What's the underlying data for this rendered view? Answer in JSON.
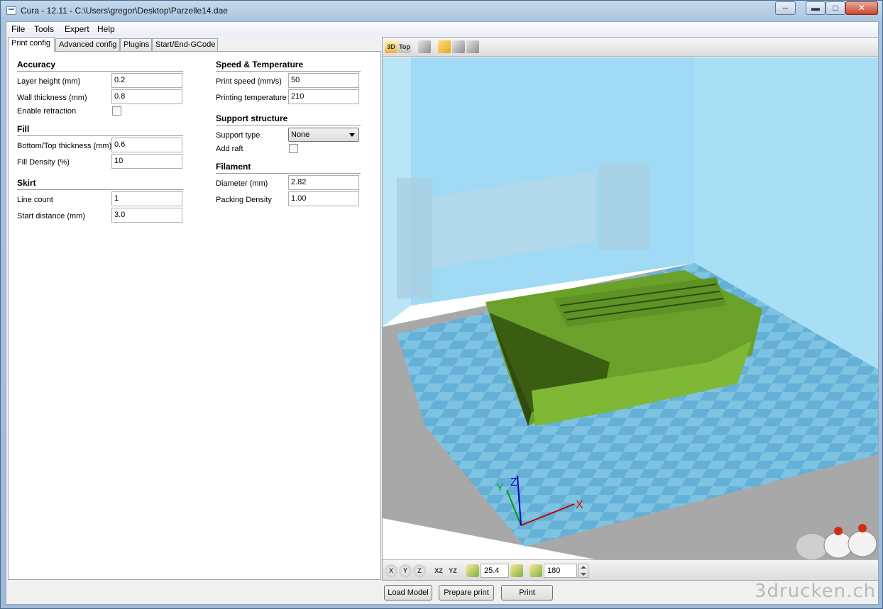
{
  "window": {
    "title": "Cura - 12.11 - C:\\Users\\gregor\\Desktop\\Parzelle14.dae",
    "restore_icon": "⇔",
    "minimize_icon": "▬",
    "maximize_icon": "□",
    "close_icon": "✕"
  },
  "menu": [
    "File",
    "Tools",
    "Expert",
    "Help"
  ],
  "tabs": [
    "Print config",
    "Advanced config",
    "Plugins",
    "Start/End-GCode"
  ],
  "sections": {
    "accuracy": {
      "title": "Accuracy",
      "layer_height_label": "Layer height (mm)",
      "layer_height": "0.2",
      "wall_thickness_label": "Wall thickness (mm)",
      "wall_thickness": "0.8",
      "enable_retraction_label": "Enable retraction",
      "enable_retraction": false
    },
    "fill": {
      "title": "Fill",
      "bottom_top_label": "Bottom/Top thickness (mm)",
      "bottom_top": "0.6",
      "fill_density_label": "Fill Density (%)",
      "fill_density": "10"
    },
    "skirt": {
      "title": "Skirt",
      "line_count_label": "Line count",
      "line_count": "1",
      "start_distance_label": "Start distance (mm)",
      "start_distance": "3.0"
    },
    "speed": {
      "title": "Speed & Temperature",
      "print_speed_label": "Print speed (mm/s)",
      "print_speed": "50",
      "temp_label": "Printing temperature",
      "temp": "210"
    },
    "support": {
      "title": "Support structure",
      "type_label": "Support type",
      "type": "None",
      "raft_label": "Add raft",
      "raft": false
    },
    "filament": {
      "title": "Filament",
      "diameter_label": "Diameter (mm)",
      "diameter": "2.82",
      "packing_label": "Packing Density",
      "packing": "1.00"
    }
  },
  "viewport": {
    "toolbar": {
      "view3d": "3D",
      "viewtop": "Top"
    },
    "axes": {
      "x": "X",
      "y": "Y",
      "z": "Z"
    },
    "bottom_toolbar": {
      "rot_x": "X",
      "rot_y": "Y",
      "rot_z": "Z",
      "mirror_xz": "XZ",
      "mirror_yz": "YZ",
      "scale": "25.4",
      "rotate": "180"
    }
  },
  "buttons": {
    "load_model": "Load Model",
    "prepare_print": "Prepare print",
    "print": "Print"
  },
  "watermark": "3drucken.ch",
  "colors": {
    "model": "#6aa12a",
    "glass": "#8fd3f2",
    "bed": "#a8a8a8",
    "grid": "#5fb0d6"
  }
}
